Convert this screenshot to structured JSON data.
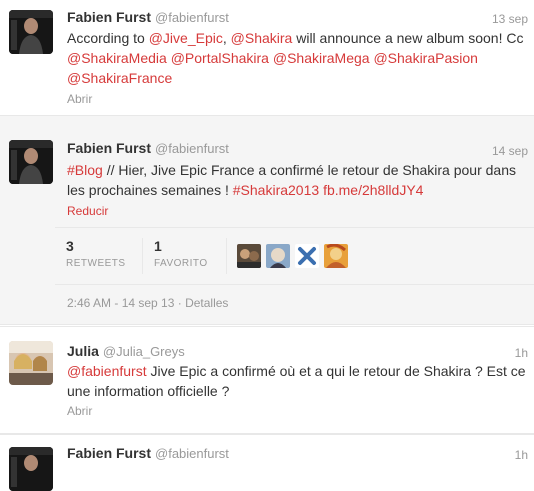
{
  "tweets": [
    {
      "name": "Fabien Furst",
      "handle": "@fabienfurst",
      "time": "13 sep",
      "segments": [
        {
          "t": "According to ",
          "link": false
        },
        {
          "t": "@Jive_Epic",
          "link": true
        },
        {
          "t": ", ",
          "link": false
        },
        {
          "t": "@Shakira",
          "link": true
        },
        {
          "t": " will announce a new album soon! Cc ",
          "link": false
        },
        {
          "t": "@ShakiraMedia",
          "link": true
        },
        {
          "t": " ",
          "link": false
        },
        {
          "t": "@PortalShakira",
          "link": true
        },
        {
          "t": " ",
          "link": false
        },
        {
          "t": "@ShakiraMega",
          "link": true
        },
        {
          "t": " ",
          "link": false
        },
        {
          "t": "@ShakiraPasion",
          "link": true
        },
        {
          "t": " ",
          "link": false
        },
        {
          "t": "@ShakiraFrance",
          "link": true
        }
      ],
      "action": "Abrir"
    },
    {
      "name": "Fabien Furst",
      "handle": "@fabienfurst",
      "time": "14 sep",
      "segments": [
        {
          "t": "#Blog",
          "link": true
        },
        {
          "t": " // Hier, Jive Epic France a confirmé le retour de Shakira pour dans les prochaines semaines ! ",
          "link": false
        },
        {
          "t": "#Shakira2013",
          "link": true
        },
        {
          "t": " ",
          "link": false
        },
        {
          "t": "fb.me/2h8lldJY4",
          "link": true
        }
      ],
      "action": "Reducir",
      "retweets_count": "3",
      "retweets_label": "RETWEETS",
      "favorites_count": "1",
      "favorites_label": "FAVORITO",
      "timestamp": "2:46 AM - 14 sep 13",
      "details_sep": " · ",
      "details_label": "Detalles"
    },
    {
      "name": "Julia",
      "handle": "@Julia_Greys",
      "time": "1h",
      "segments": [
        {
          "t": "@fabienfurst",
          "link": true
        },
        {
          "t": " Jive Epic a  confirmé où et a qui le retour de Shakira ? Est ce une information officielle ?",
          "link": false
        }
      ],
      "action": "Abrir"
    },
    {
      "name": "Fabien Furst",
      "handle": "@fabienfurst",
      "time": "1h"
    }
  ],
  "colors": {
    "link": "#d63a3a",
    "muted": "#999999",
    "text": "#333333",
    "expanded_bg": "#f5f5f5"
  }
}
